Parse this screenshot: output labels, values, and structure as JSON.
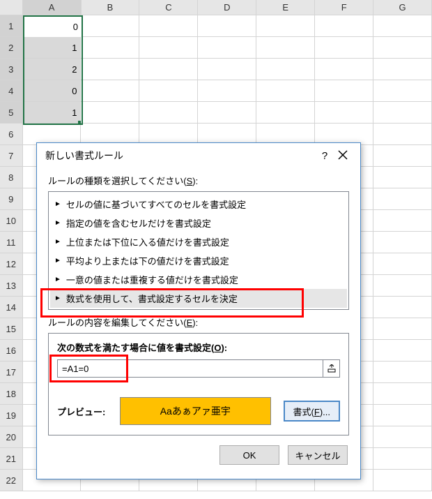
{
  "cols": [
    "A",
    "B",
    "C",
    "D",
    "E",
    "F",
    "G"
  ],
  "rows": [
    "1",
    "2",
    "3",
    "4",
    "5",
    "6",
    "7",
    "8",
    "9",
    "10",
    "11",
    "12",
    "13",
    "14",
    "15",
    "16",
    "17",
    "18",
    "19",
    "20",
    "21",
    "22"
  ],
  "cells": {
    "A1": "0",
    "A2": "1",
    "A3": "2",
    "A4": "0",
    "A5": "1"
  },
  "dialog": {
    "title": "新しい書式ルール",
    "help": "?",
    "section1": {
      "label_prefix": "ルールの種類を選択してください(",
      "u": "S",
      "label_suffix": "):"
    },
    "rules": [
      "セルの値に基づいてすべてのセルを書式設定",
      "指定の値を含むセルだけを書式設定",
      "上位または下位に入る値だけを書式設定",
      "平均より上または下の値だけを書式設定",
      "一意の値または重複する値だけを書式設定",
      "数式を使用して、書式設定するセルを決定"
    ],
    "section2": {
      "label_prefix": "ルールの内容を編集してください(",
      "u": "E",
      "label_suffix": "):"
    },
    "formula_head": {
      "prefix": "次の数式を満たす場合に値を書式設定(",
      "u": "O",
      "suffix": "):"
    },
    "formula": "=A1=0",
    "preview_label": "プレビュー:",
    "preview_sample": "Aaあぁアァ亜宇",
    "format_btn": {
      "prefix": "書式(",
      "u": "F",
      "suffix": ")..."
    },
    "ok": "OK",
    "cancel": "キャンセル"
  }
}
